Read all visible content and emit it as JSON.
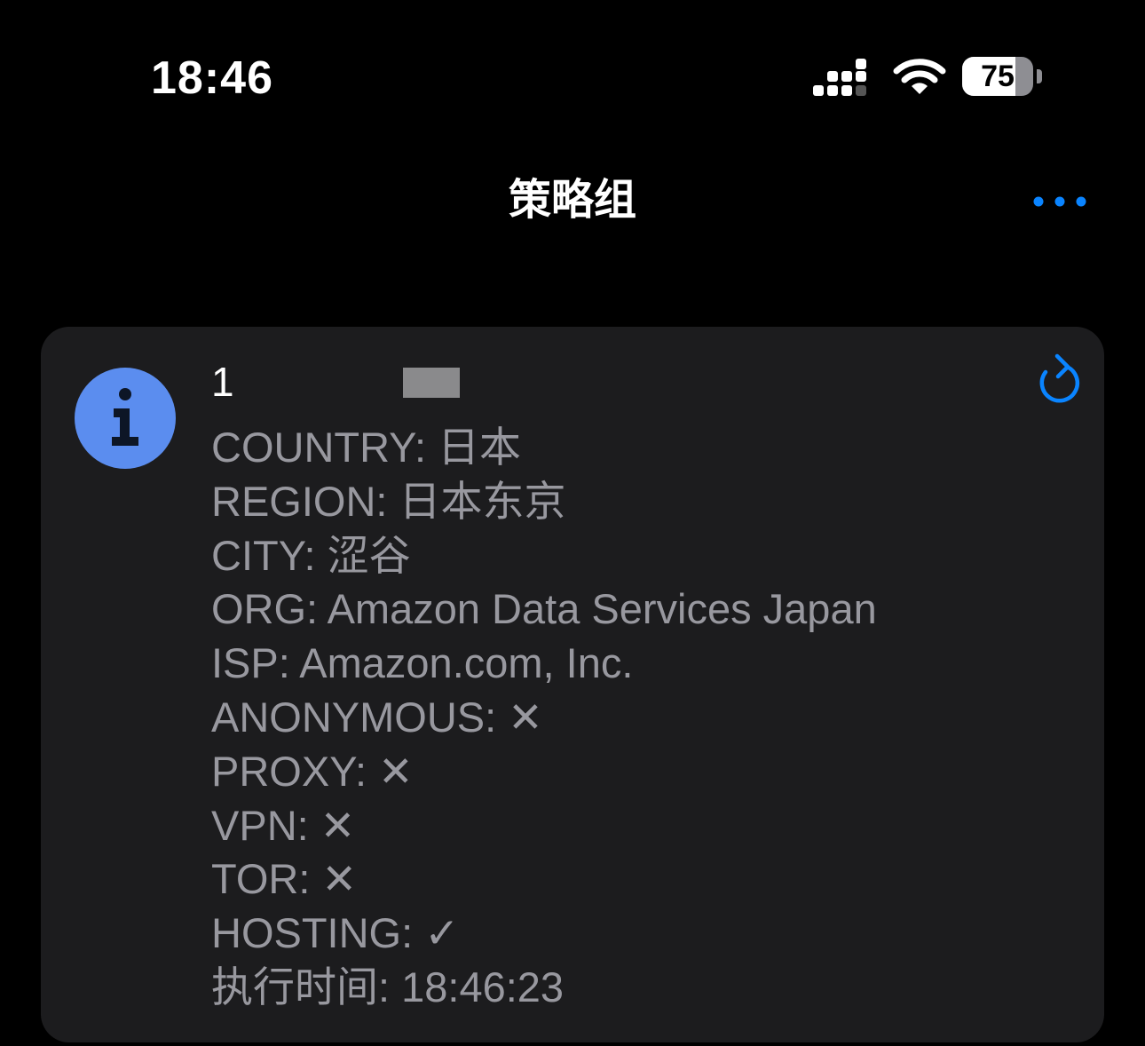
{
  "status_bar": {
    "time": "18:46",
    "battery_level": "75",
    "battery_fraction": 0.75
  },
  "nav": {
    "title": "策略组"
  },
  "card": {
    "ip_prefix": "1",
    "lines": [
      "COUNTRY: 日本",
      "REGION: 日本东京",
      "CITY: 涩谷",
      "ORG: Amazon Data Services Japan",
      "ISP: Amazon.com, Inc.",
      "ANONYMOUS: ✕",
      "PROXY: ✕",
      "VPN: ✕",
      "TOR: ✕",
      "HOSTING: ✓",
      "执行时间: 18:46:23"
    ]
  },
  "icons": {
    "status": [
      "signal-icon",
      "wifi-icon",
      "battery-icon"
    ],
    "nav": [
      "more-icon"
    ],
    "card": [
      "info-icon",
      "refresh-icon"
    ]
  },
  "colors": {
    "background": "#000000",
    "card": "#1c1c1e",
    "accent": "#0a84ff",
    "info_circle": "#5b8def",
    "secondary_text": "#98989f"
  }
}
